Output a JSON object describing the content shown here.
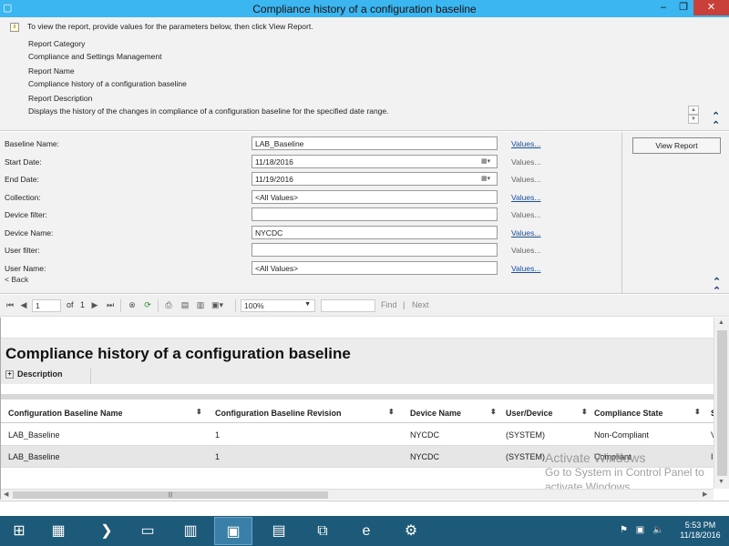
{
  "window": {
    "title": "Compliance history of a configuration baseline",
    "minimize_icon": "minimize-icon",
    "restore_icon": "restore-icon",
    "close_icon": "close-icon"
  },
  "header": {
    "instructions": "To view the report, provide values for the parameters below, then click View Report.",
    "category_label": "Report Category",
    "category_value": "Compliance and Settings Management",
    "name_label": "Report Name",
    "name_value": "Compliance history of a configuration baseline",
    "description_label": "Report Description",
    "description_value": "Displays the history of the changes in compliance of a configuration baseline for the specified date range."
  },
  "params": [
    {
      "label": "Baseline Name:",
      "value": "LAB_Baseline",
      "values_link": "Values...",
      "link_enabled": true,
      "date": false
    },
    {
      "label": "Start Date:",
      "value": "11/18/2016",
      "values_link": "Values...",
      "link_enabled": false,
      "date": true
    },
    {
      "label": "End Date:",
      "value": "11/19/2016",
      "values_link": "Values...",
      "link_enabled": false,
      "date": true
    },
    {
      "label": "Collection:",
      "value": "<All Values>",
      "values_link": "Values...",
      "link_enabled": true,
      "date": false
    },
    {
      "label": "Device filter:",
      "value": "",
      "values_link": "Values...",
      "link_enabled": false,
      "date": false
    },
    {
      "label": "Device Name:",
      "value": "NYCDC",
      "values_link": "Values...",
      "link_enabled": true,
      "date": false
    },
    {
      "label": "User filter:",
      "value": "",
      "values_link": "Values...",
      "link_enabled": false,
      "date": false
    },
    {
      "label": "User Name:",
      "value": "<All Values>",
      "values_link": "Values...",
      "link_enabled": true,
      "date": false
    }
  ],
  "back_label": "< Back",
  "view_report_label": "View Report",
  "toolbar": {
    "page_current": "1",
    "page_of": "of",
    "page_total": "1",
    "zoom": "100%",
    "find_label": "Find",
    "separator": "|",
    "next_label": "Next"
  },
  "report": {
    "title": "Compliance history of a configuration baseline",
    "description_toggle": "Description",
    "columns": [
      "Configuration Baseline Name",
      "Configuration Baseline Revision",
      "Device Name",
      "User/Device",
      "Compliance State",
      "S"
    ],
    "rows": [
      [
        "LAB_Baseline",
        "1",
        "NYCDC",
        "(SYSTEM)",
        "Non-Compliant",
        "V"
      ],
      [
        "LAB_Baseline",
        "1",
        "NYCDC",
        "(SYSTEM)",
        "Compliant",
        "I"
      ]
    ]
  },
  "watermark": {
    "line1": "Activate Windows",
    "line2": "Go to System in Control Panel to",
    "line3": "activate Windows."
  },
  "taskbar": {
    "items": [
      "windows-start-icon",
      "server-manager-icon",
      "powershell-icon",
      "file-explorer-icon",
      "tools-icon",
      "report-viewer-icon",
      "remote-desktop-icon",
      "network-icon",
      "internet-explorer-icon",
      "settings-icon"
    ],
    "time": "5:53 PM",
    "date": "11/18/2016"
  },
  "colors": {
    "titlebar": "#3cb6f0",
    "close": "#c9403a",
    "taskbar": "#1d5a7a",
    "link": "#1a4fa3"
  }
}
